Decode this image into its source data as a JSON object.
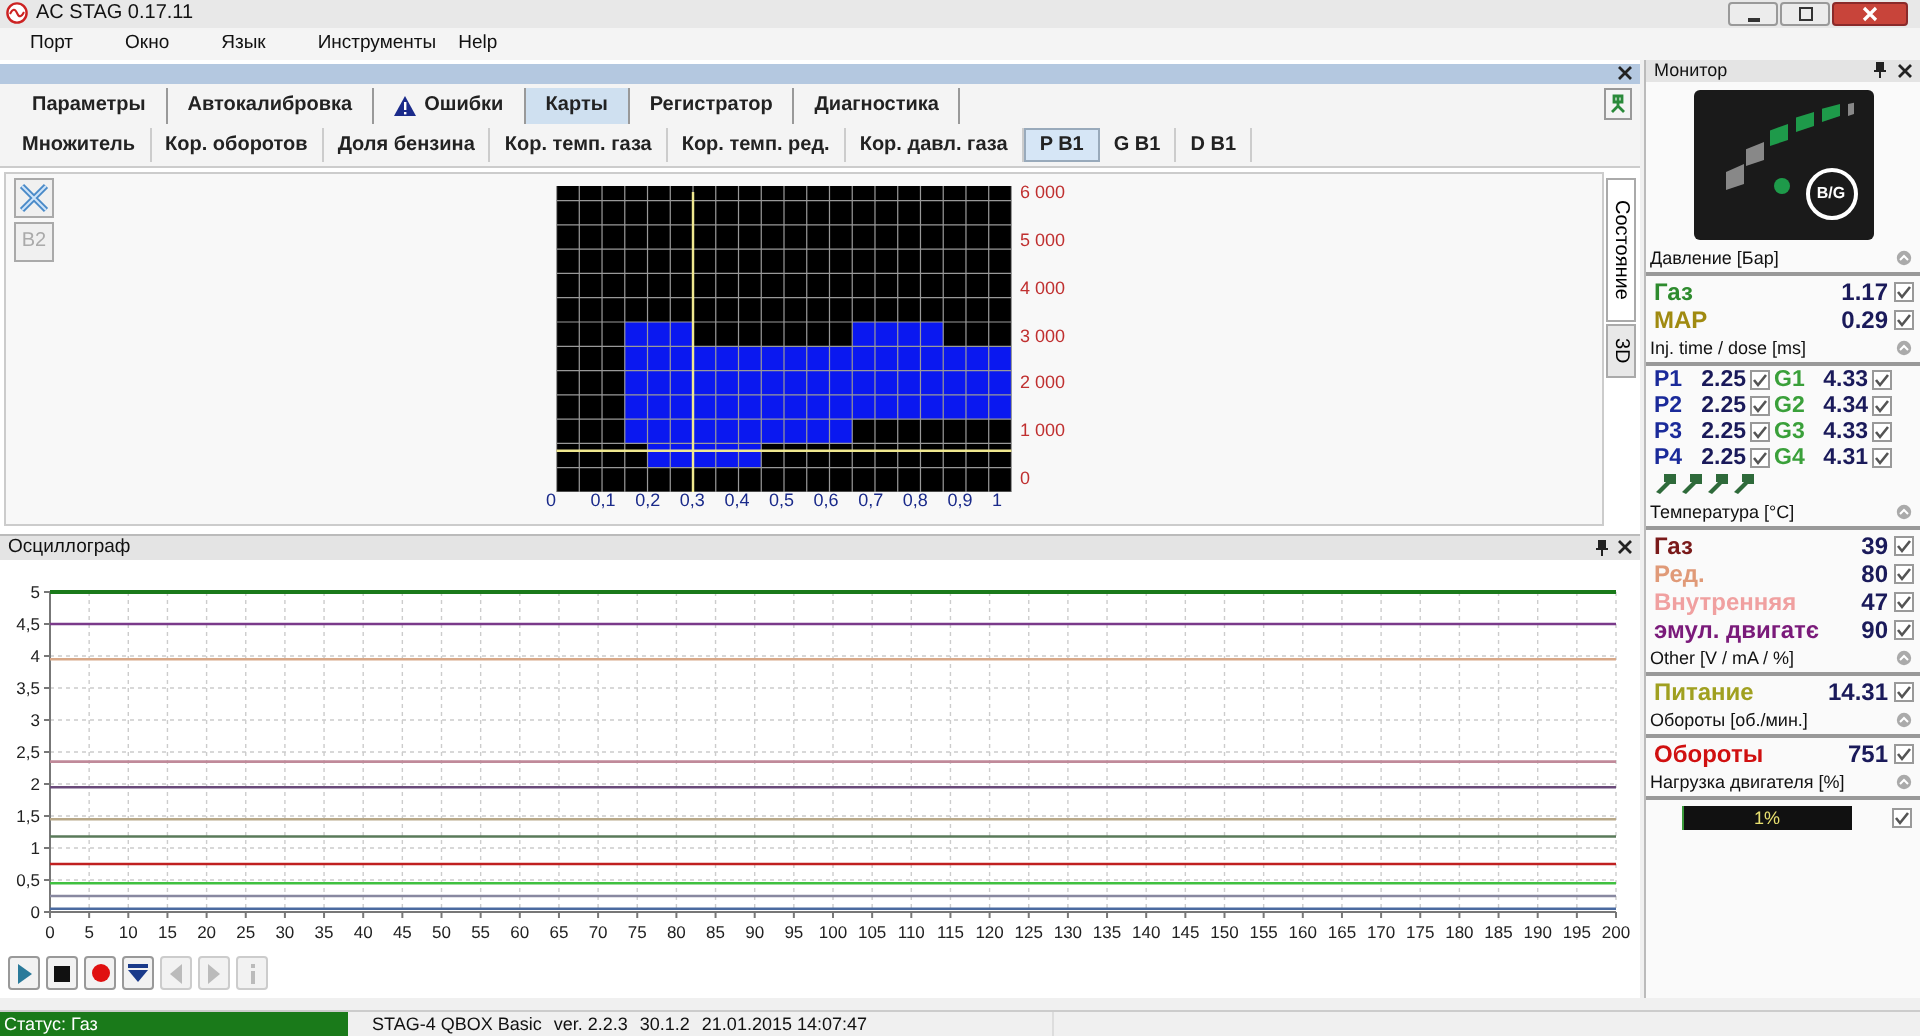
{
  "window": {
    "title": "AC STAG 0.17.11"
  },
  "menu": [
    "Порт",
    "Окно",
    "Язык",
    "Инструменты",
    "Help"
  ],
  "tabs": [
    {
      "label": "Параметры",
      "selected": false,
      "warning": false
    },
    {
      "label": "Автокалибровка",
      "selected": false,
      "warning": false
    },
    {
      "label": "Ошибки",
      "selected": false,
      "warning": true
    },
    {
      "label": "Карты",
      "selected": true,
      "warning": false
    },
    {
      "label": "Регистратор",
      "selected": false,
      "warning": false
    },
    {
      "label": "Диагностика",
      "selected": false,
      "warning": false
    }
  ],
  "subtabs": [
    {
      "label": "Множитель",
      "selected": false
    },
    {
      "label": "Кор. оборотов",
      "selected": false
    },
    {
      "label": "Доля бензина",
      "selected": false
    },
    {
      "label": "Кор. темп. газа",
      "selected": false
    },
    {
      "label": "Кор. темп. ред.",
      "selected": false
    },
    {
      "label": "Кор. давл. газа",
      "selected": false
    },
    {
      "label": "P B1",
      "selected": true
    },
    {
      "label": "G B1",
      "selected": false
    },
    {
      "label": "D B1",
      "selected": false
    }
  ],
  "map": {
    "b2_button": {
      "label": "B2",
      "disabled": true
    },
    "x_ticks": [
      "0",
      "0,1",
      "0,2",
      "0,3",
      "0,4",
      "0,5",
      "0,6",
      "0,7",
      "0,8",
      "0,9",
      "1"
    ],
    "y_ticks": [
      "6 000",
      "5 000",
      "4 000",
      "3 000",
      "2 000",
      "1 000",
      "0"
    ],
    "side_tabs": [
      {
        "label": "Состояние",
        "selected": true
      },
      {
        "label": "3D",
        "selected": false
      }
    ]
  },
  "oscillograph": {
    "title": "Осциллограф",
    "chart_data": {
      "type": "line",
      "grid": true,
      "x": [
        0,
        200
      ],
      "xlim": [
        0,
        200
      ],
      "ylim": [
        0,
        5
      ],
      "xticks": [
        0,
        5,
        10,
        15,
        20,
        25,
        30,
        35,
        40,
        45,
        50,
        55,
        60,
        65,
        70,
        75,
        80,
        85,
        90,
        95,
        100,
        105,
        110,
        115,
        120,
        125,
        130,
        135,
        140,
        145,
        150,
        155,
        160,
        165,
        170,
        175,
        180,
        185,
        190,
        195,
        200
      ],
      "yticks": [
        0,
        {
          "value": 0.5,
          "label": "0,5"
        },
        1,
        {
          "value": 1.5,
          "label": "1,5"
        },
        2,
        {
          "value": 2.5,
          "label": "2,5"
        },
        3,
        {
          "value": 3.5,
          "label": "3,5"
        },
        4,
        {
          "value": 4.5,
          "label": "4,5"
        },
        5
      ],
      "series": [
        {
          "color": "#1a7a1a",
          "values": [
            5,
            5
          ]
        },
        {
          "color": "#7a3a8a",
          "values": [
            4.5,
            4.5
          ]
        },
        {
          "color": "#d8a888",
          "values": [
            3.95,
            3.95
          ]
        },
        {
          "color": "#c08a9a",
          "values": [
            2.35,
            2.35
          ]
        },
        {
          "color": "#6a4a7a",
          "values": [
            1.95,
            1.95
          ]
        },
        {
          "color": "#b8a888",
          "values": [
            1.45,
            1.45
          ]
        },
        {
          "color": "#5a7a5a",
          "values": [
            1.18,
            1.18
          ]
        },
        {
          "color": "#c02020",
          "values": [
            0.75,
            0.75
          ]
        },
        {
          "color": "#40c040",
          "values": [
            0.45,
            0.45
          ]
        },
        {
          "color": "#8888a0",
          "values": [
            0.25,
            0.25
          ]
        },
        {
          "color": "#4a6aa0",
          "values": [
            0.05,
            0.05
          ]
        }
      ]
    },
    "controls": [
      {
        "kind": "play",
        "disabled": false
      },
      {
        "kind": "stop",
        "disabled": false
      },
      {
        "kind": "record",
        "disabled": false
      },
      {
        "kind": "down",
        "disabled": false
      },
      {
        "kind": "left",
        "disabled": true
      },
      {
        "kind": "right",
        "disabled": true
      },
      {
        "kind": "info",
        "disabled": true
      }
    ]
  },
  "monitor": {
    "title": "Монитор",
    "gauge_label": "B/G",
    "sections": [
      {
        "kind": "values",
        "title": "Давление [Бар]",
        "rows": [
          {
            "label": "Газ",
            "value": "1.17",
            "color": "#2e8b2e",
            "checked": true
          },
          {
            "label": "MAP",
            "value": "0.29",
            "color": "#a08a10",
            "checked": true
          }
        ]
      },
      {
        "kind": "injectors",
        "title": "Inj. time / dose [ms]",
        "rows": [
          {
            "p_label": "P1",
            "p_value": "2.25",
            "p_checked": true,
            "g_label": "G1",
            "g_value": "4.33",
            "g_checked": true
          },
          {
            "p_label": "P2",
            "p_value": "2.25",
            "p_checked": true,
            "g_label": "G2",
            "g_value": "4.34",
            "g_checked": true
          },
          {
            "p_label": "P3",
            "p_value": "2.25",
            "p_checked": true,
            "g_label": "G3",
            "g_value": "4.33",
            "g_checked": true
          },
          {
            "p_label": "P4",
            "p_value": "2.25",
            "p_checked": true,
            "g_label": "G4",
            "g_value": "4.31",
            "g_checked": true
          }
        ]
      },
      {
        "kind": "values",
        "title": "Температура [°C]",
        "rows": [
          {
            "label": "Газ",
            "value": "39",
            "color": "#7a1a1a",
            "checked": true
          },
          {
            "label": "Ред.",
            "value": "80",
            "color": "#e09a78",
            "checked": true
          },
          {
            "label": "Внутренняя",
            "value": "47",
            "color": "#f0a0a0",
            "checked": true
          },
          {
            "label": "эмул. двигатє",
            "value": "90",
            "color": "#7a1a7a",
            "checked": true
          }
        ]
      },
      {
        "kind": "values",
        "title": "Other [V / mA / %]",
        "rows": [
          {
            "label": "Питание",
            "value": "14.31",
            "color": "#a0a020",
            "checked": true
          }
        ]
      },
      {
        "kind": "values",
        "title": "Обороты [об./мин.]",
        "rows": [
          {
            "label": "Обороты",
            "value": "751",
            "color": "#d01010",
            "checked": true
          }
        ]
      },
      {
        "kind": "load",
        "title": "Нагрузка двигателя [%]",
        "level": 0.01,
        "reading": "1%",
        "checked": true
      }
    ]
  },
  "status_bar": {
    "status": "Статус: Газ",
    "info": [
      "STAG-4 QBOX Basic",
      "ver. 2.2.3",
      "30.1.2",
      "21.01.2015 14:07:47"
    ]
  }
}
